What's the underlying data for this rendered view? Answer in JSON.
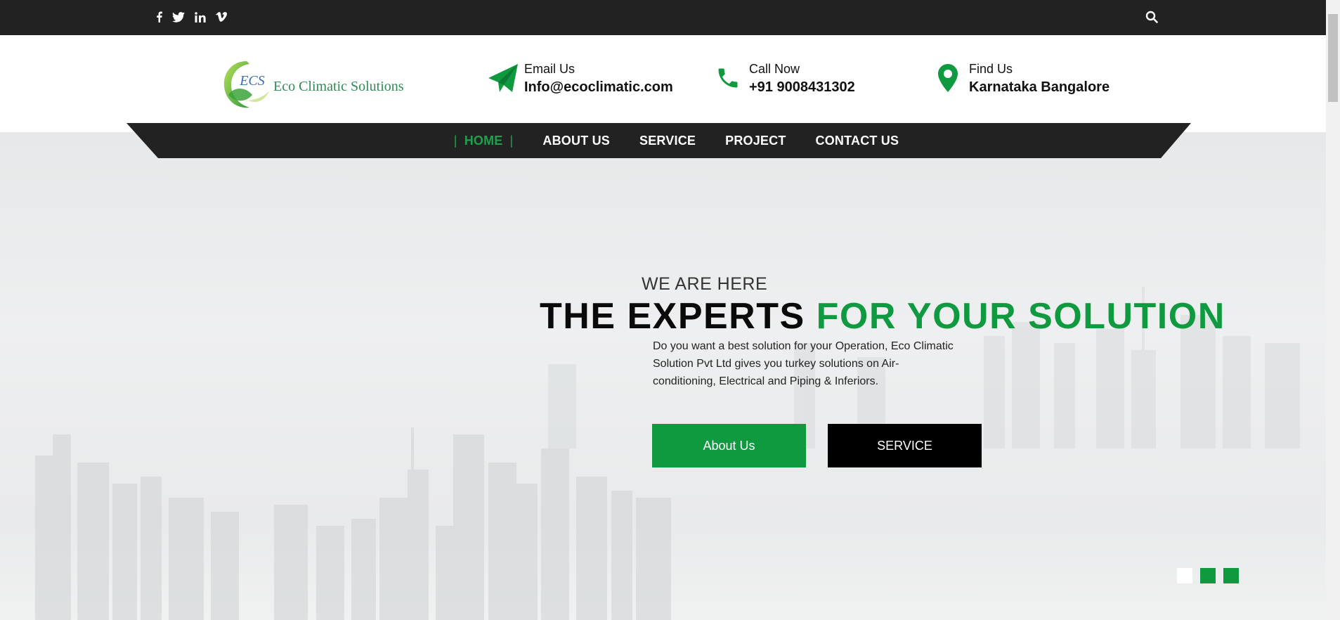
{
  "topbar": {
    "social": [
      {
        "name": "facebook-icon",
        "glyph": "f"
      },
      {
        "name": "twitter-icon",
        "glyph": "t"
      },
      {
        "name": "linkedin-icon",
        "glyph": "in"
      },
      {
        "name": "vimeo-icon",
        "glyph": "v"
      }
    ],
    "search_icon": "search-icon"
  },
  "brand": {
    "name": "Eco Climatic Solutions",
    "mark_text": "ECS",
    "color": "#2e8b57"
  },
  "contacts": [
    {
      "label": "Email Us",
      "value": "Info@ecoclimatic.com",
      "icon": "paper-plane-icon"
    },
    {
      "label": "Call Now",
      "value": "+91 9008431302",
      "icon": "phone-icon"
    },
    {
      "label": "Find Us",
      "value": "Karnataka Bangalore",
      "icon": "map-pin-icon"
    }
  ],
  "nav": {
    "items": [
      "HOME",
      "ABOUT US",
      "SERVICE",
      "PROJECT",
      "CONTACT US"
    ],
    "active": "HOME"
  },
  "hero": {
    "eyebrow": "WE ARE HERE",
    "headline_dark": "THE EXPERTS",
    "headline_green": "FOR YOUR SOLUTION",
    "description": "Do you want a best solution for your Operation, Eco Climatic Solution Pvt Ltd gives you turkey solutions on Air-conditioning, Electrical and Piping & Inferiors.",
    "buttons": {
      "about": "About Us",
      "service": "SERVICE"
    },
    "slides": 3,
    "active_slide": 1
  },
  "colors": {
    "accent": "#0f9a40",
    "topbar": "#222222",
    "nav": "#222222"
  }
}
